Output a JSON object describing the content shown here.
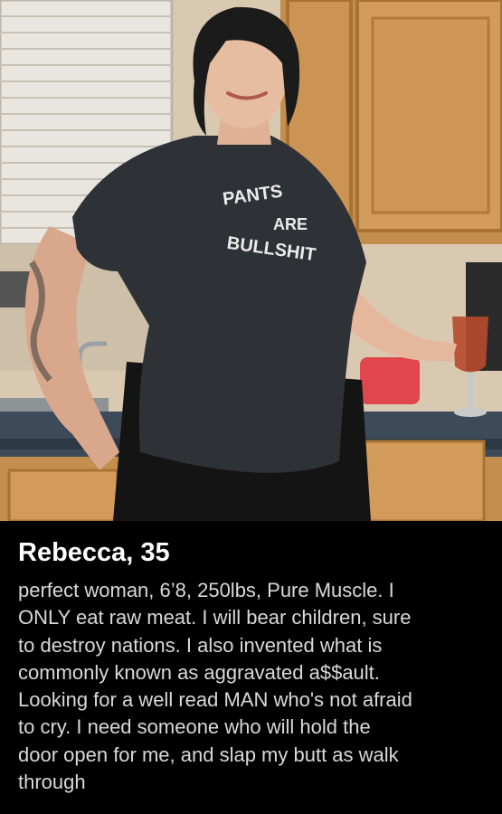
{
  "profile": {
    "name_age": "Rebecca, 35",
    "bio": "perfect woman, 6’8, 250lbs, Pure Muscle. I\nONLY eat raw meat. I will bear children, sure\nto destroy nations. I also invented what is\ncommonly known as aggravated a$$ault.\nLooking for a well read MAN who's not afraid\nto cry.  I need someone who will hold the\ndoor open for me, and slap my butt as walk\nthrough"
  },
  "photo": {
    "shirt_text_line1": "PANTS",
    "shirt_text_line2": "ARE",
    "shirt_text_line3": "BULLSHIT"
  },
  "colors": {
    "cabinet": "#c9a574",
    "countertop": "#3c4a5a",
    "shirt": "#2e3136",
    "leggings": "#141414",
    "background_panel": "#000000",
    "name_text": "#ffffff",
    "bio_text": "#d9d9d9"
  }
}
